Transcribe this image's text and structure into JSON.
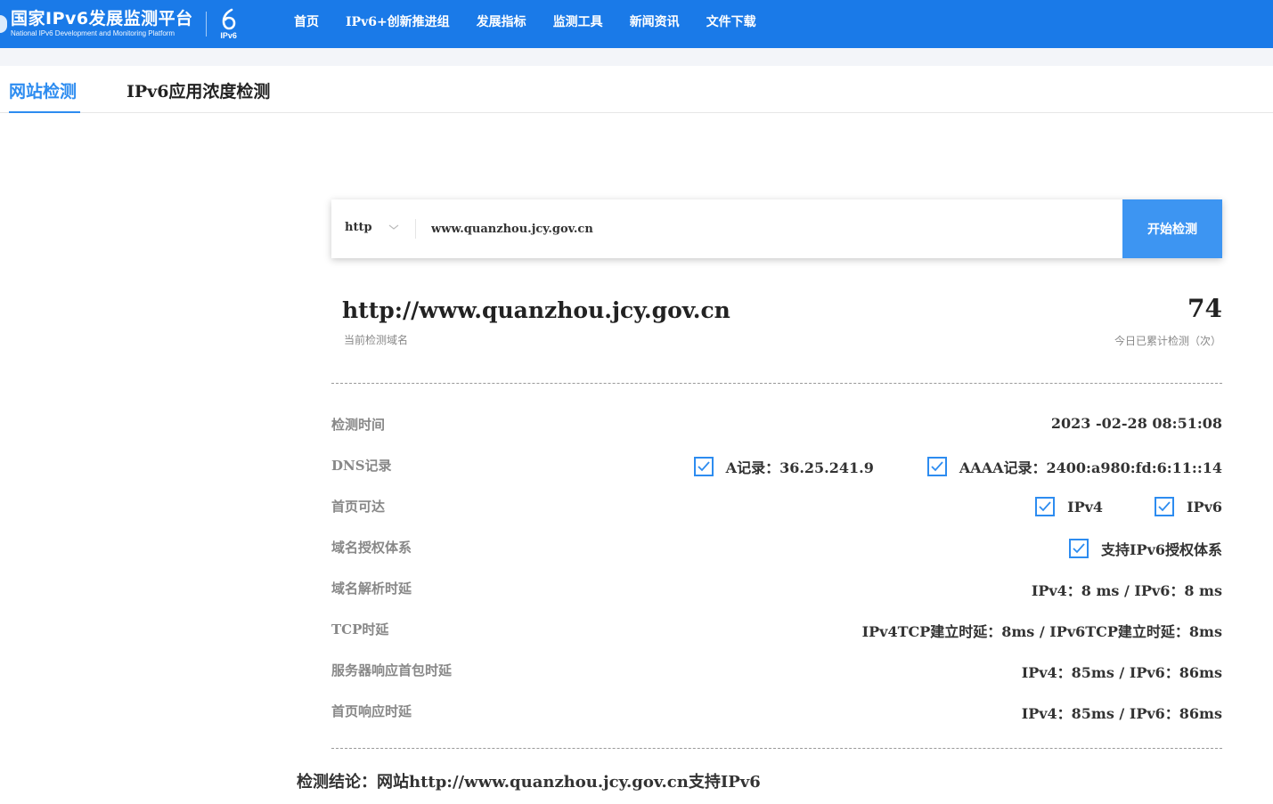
{
  "header": {
    "brand_cn": "国家IPv6发展监测平台",
    "brand_en": "National IPv6 Development and Monitoring Platform",
    "brand_logo_label": "IPv6",
    "nav": [
      "首页",
      "IPv6+创新推进组",
      "发展指标",
      "监测工具",
      "新闻资讯",
      "文件下载"
    ],
    "colors": {
      "primary": "#1a7ae8",
      "accent": "#2d8cf0"
    }
  },
  "tabs": {
    "website_check": "网站检测",
    "app_density_check": "IPv6应用浓度检测",
    "active": "网站检测"
  },
  "search": {
    "protocol": "http",
    "url_value": "www.quanzhou.jcy.gov.cn",
    "start_button": "开始检测"
  },
  "summary": {
    "domain": "http://www.quanzhou.jcy.gov.cn",
    "domain_label": "当前检测域名",
    "count": "74",
    "count_label": "今日已累计检测（次）"
  },
  "results": {
    "check_time": {
      "label": "检测时间",
      "value": "2023 -02-28 08:51:08"
    },
    "dns": {
      "label": "DNS记录",
      "a_record": "A记录：36.25.241.9",
      "aaaa_record": "AAAA记录：2400:a980:fd:6:11::14"
    },
    "homepage_reach": {
      "label": "首页可达",
      "ipv4": "IPv4",
      "ipv6": "IPv6"
    },
    "domain_auth": {
      "label": "域名授权体系",
      "value": "支持IPv6授权体系"
    },
    "dns_latency": {
      "label": "域名解析时延",
      "value": "IPv4：8 ms / IPv6：8 ms"
    },
    "tcp_latency": {
      "label": "TCP时延",
      "value": "IPv4TCP建立时延：8ms / IPv6TCP建立时延：8ms"
    },
    "first_packet": {
      "label": "服务器响应首包时延",
      "value": "IPv4：85ms / IPv6：86ms"
    },
    "homepage_response": {
      "label": "首页响应时延",
      "value": "IPv4：85ms / IPv6：86ms"
    }
  },
  "conclusion": "检测结论：网站http://www.quanzhou.jcy.gov.cn支持IPv6"
}
